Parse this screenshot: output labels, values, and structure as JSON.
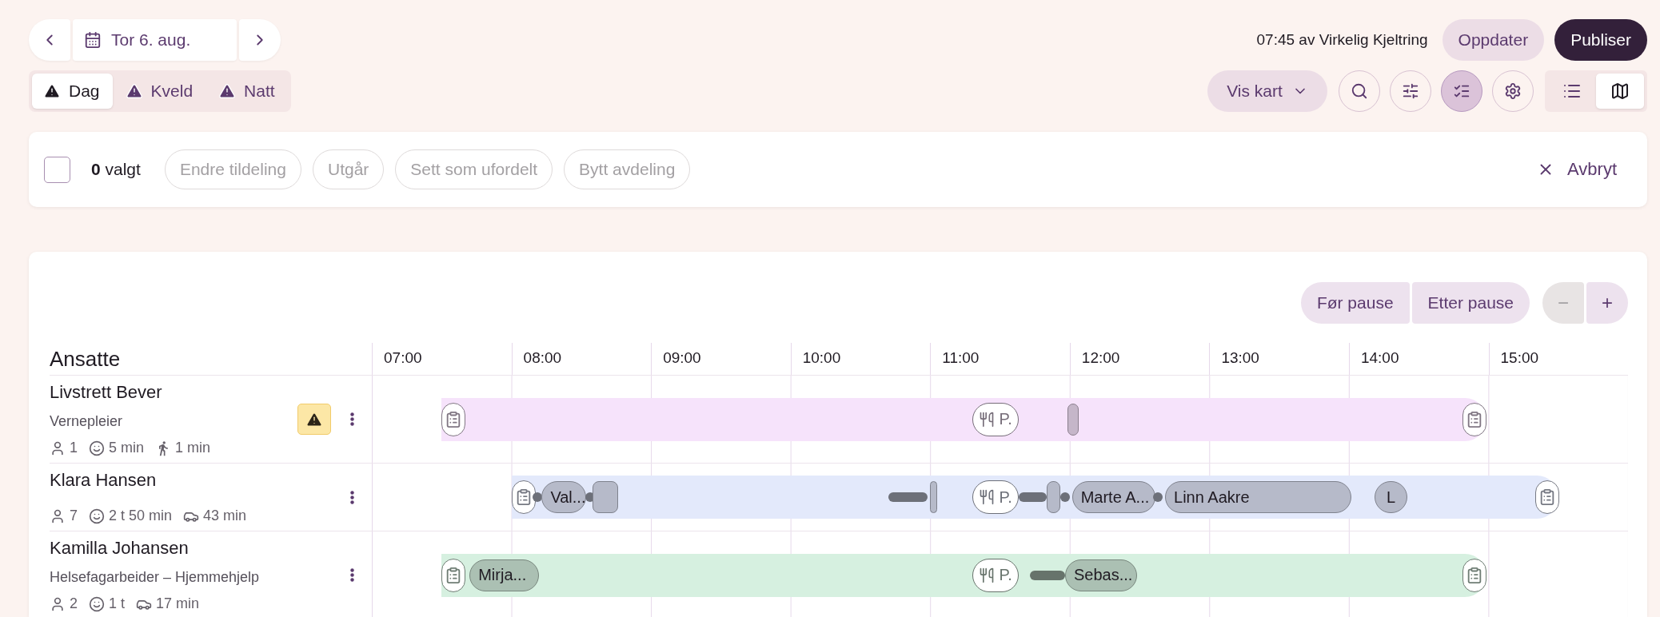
{
  "date_nav": {
    "date": "Tor 6. aug."
  },
  "shifts": [
    {
      "label": "Dag",
      "selected": true,
      "warning": true
    },
    {
      "label": "Kveld",
      "selected": false,
      "warning": true
    },
    {
      "label": "Natt",
      "selected": false,
      "warning": true
    }
  ],
  "publish": {
    "status": "07:45 av Virkelig Kjeltring",
    "buttons": [
      {
        "label": "Oppdater",
        "kind": "secondary"
      },
      {
        "label": "Publiser",
        "kind": "primary"
      }
    ]
  },
  "toolbar": {
    "map_select": "Vis kart",
    "tools": [
      {
        "kind": "search",
        "selected": false
      },
      {
        "kind": "filter",
        "selected": false
      },
      {
        "kind": "select",
        "selected": true
      },
      {
        "kind": "settings",
        "selected": false
      }
    ],
    "views": [
      {
        "kind": "list",
        "selected": false
      },
      {
        "kind": "map",
        "selected": true
      }
    ]
  },
  "selection_bar": {
    "checked": false,
    "count": "**0** valgt",
    "actions": [
      {
        "label": "Endre tildeling",
        "disabled": true
      },
      {
        "label": "Utgår",
        "disabled": true
      },
      {
        "label": "Sett som ufordelt",
        "disabled": true
      },
      {
        "label": "Bytt avdeling",
        "disabled": true
      }
    ],
    "cancel": "Avbryt"
  },
  "schedule": {
    "pause_buttons": [
      "Før pause",
      "Etter pause"
    ],
    "zoom": [
      {
        "label": "−",
        "disabled": true
      },
      {
        "label": "+",
        "disabled": false
      }
    ],
    "column_title": "Ansatte",
    "hours": [
      "07:00",
      "08:00",
      "09:00",
      "10:00",
      "11:00",
      "12:00",
      "13:00",
      "14:00",
      "15:00"
    ],
    "employees": [
      {
        "name": "Livstrett Bever",
        "role": "Vernepleier",
        "warning": true,
        "color": "#f6e3fb",
        "stats": [
          {
            "kind": "clients",
            "text": "1"
          },
          {
            "kind": "time",
            "text": "5 min"
          },
          {
            "kind": "walk",
            "text": "1 min"
          }
        ],
        "items": [
          {
            "kind": "clipboard"
          },
          {
            "kind": "meal",
            "label": "P."
          },
          {
            "kind": "block"
          },
          {
            "kind": "clipboard"
          }
        ]
      },
      {
        "name": "Klara Hansen",
        "warning": false,
        "color": "#e3e9fb",
        "stats": [
          {
            "kind": "clients",
            "text": "7"
          },
          {
            "kind": "time",
            "text": "2 t 50 min"
          },
          {
            "kind": "car",
            "text": "43 min"
          }
        ],
        "items": [
          {
            "kind": "clipboard"
          },
          {
            "kind": "dot"
          },
          {
            "kind": "visit",
            "label": "Val..."
          },
          {
            "kind": "dot"
          },
          {
            "kind": "block"
          },
          {
            "kind": "travel"
          },
          {
            "kind": "block"
          },
          {
            "kind": "meal",
            "label": "P."
          },
          {
            "kind": "travel"
          },
          {
            "kind": "block"
          },
          {
            "kind": "dot"
          },
          {
            "kind": "visit",
            "label": "Marte A..."
          },
          {
            "kind": "dot"
          },
          {
            "kind": "visit",
            "label": "Linn Aakre"
          },
          {
            "kind": "visit",
            "label": "L"
          },
          {
            "kind": "clipboard"
          }
        ]
      },
      {
        "name": "Kamilla Johansen",
        "role": "Helsefagarbeider – Hjemmehjelp",
        "warning": false,
        "color": "#d6f0e0",
        "stats": [
          {
            "kind": "clients",
            "text": "2"
          },
          {
            "kind": "time",
            "text": "1 t"
          },
          {
            "kind": "car",
            "text": "17 min"
          }
        ],
        "items": [
          {
            "kind": "clipboard"
          },
          {
            "kind": "visit",
            "label": "Mirja..."
          },
          {
            "kind": "meal",
            "label": "P."
          },
          {
            "kind": "travel"
          },
          {
            "kind": "visit",
            "label": "Sebas..."
          },
          {
            "kind": "clipboard"
          }
        ]
      }
    ]
  }
}
